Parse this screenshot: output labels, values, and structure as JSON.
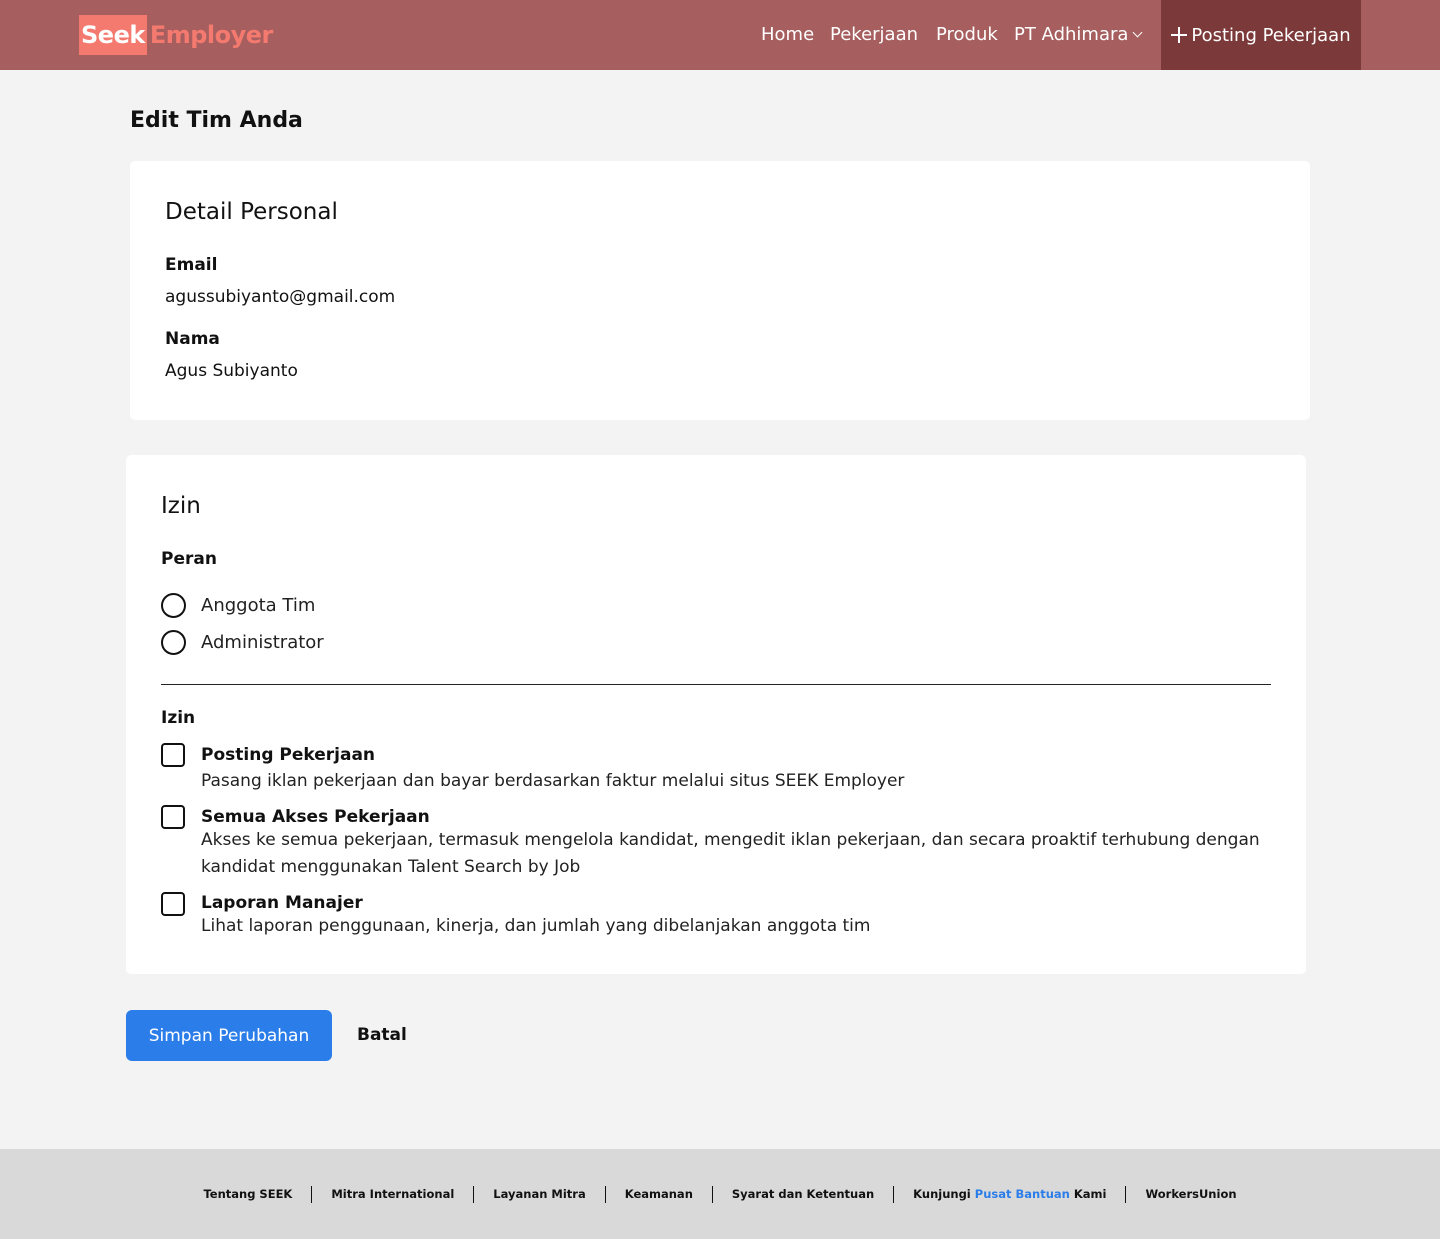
{
  "header": {
    "logo": {
      "seek": "Seek",
      "employer": "Employer"
    },
    "nav": [
      {
        "label": "Home"
      },
      {
        "label": "Pekerjaan"
      },
      {
        "label": "Produk"
      },
      {
        "label": "PT Adhimara"
      }
    ],
    "post_button": "Posting Pekerjaan",
    "colors": {
      "header_bg": "#a65e5e",
      "post_bg": "#7b3939",
      "logo": "#f47a6f"
    }
  },
  "page_title": "Edit Tim Anda",
  "personal": {
    "title": "Detail Personal",
    "email_label": "Email",
    "email_value": "agussubiyanto@gmail.com",
    "name_label": "Nama",
    "name_value": "Agus Subiyanto"
  },
  "permissions": {
    "title": "Izin",
    "role_label": "Peran",
    "roles": [
      {
        "label": "Anggota Tim",
        "selected": false
      },
      {
        "label": "Administrator",
        "selected": false
      }
    ],
    "perm_label": "Izin",
    "items": [
      {
        "title": "Posting Pekerjaan",
        "desc": "Pasang iklan pekerjaan dan bayar berdasarkan faktur melalui situs SEEK Employer",
        "checked": false
      },
      {
        "title": "Semua Akses Pekerjaan",
        "desc": "Akses ke semua pekerjaan, termasuk mengelola kandidat, mengedit iklan pekerjaan, dan secara proaktif terhubung dengan kandidat menggunakan Talent Search by Job",
        "checked": false
      },
      {
        "title": "Laporan Manajer",
        "desc": "Lihat laporan penggunaan, kinerja, dan jumlah yang dibelanjakan anggota tim",
        "checked": false
      }
    ]
  },
  "actions": {
    "save": "Simpan Perubahan",
    "cancel": "Batal",
    "accent": "#2b7de9"
  },
  "footer": {
    "links": [
      "Tentang SEEK",
      "Mitra International",
      "Layanan Mitra",
      "Keamanan",
      "Syarat dan Ketentuan"
    ],
    "help": {
      "pre": "Kunjungi",
      "link": "Pusat Bantuan",
      "post": "Kami"
    },
    "last": "WorkersUnion"
  }
}
